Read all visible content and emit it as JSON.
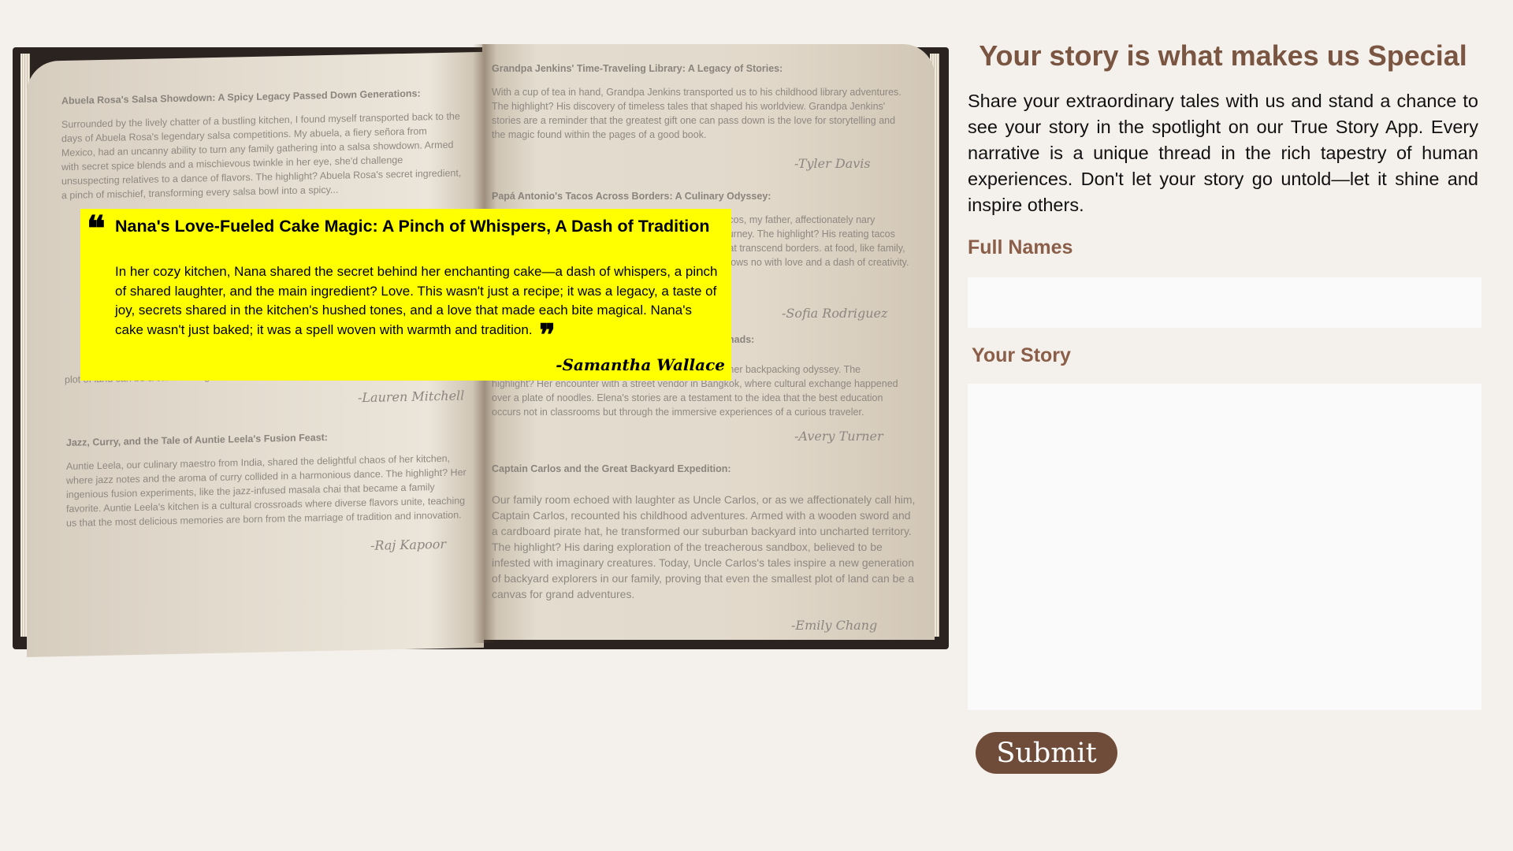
{
  "book": {
    "left_page": [
      {
        "title": "Abuela Rosa's Salsa Showdown: A Spicy Legacy Passed Down Generations:",
        "body": "Surrounded by the lively chatter of a bustling kitchen, I found myself transported back to the days of Abuela Rosa's legendary salsa competitions. My abuela, a fiery señora from Mexico, had an uncanny ability to turn any family gathering into a salsa showdown. Armed with secret spice blends and a mischievous twinkle in her eye, she'd challenge unsuspecting relatives to a dance of flavors. The highlight? Abuela Rosa's secret ingredient, a pinch of mischief, transforming every salsa bowl into a spicy..."
      },
      {
        "title": "",
        "body": "plot of land can be a canvas for grand adventures.",
        "author": "-Lauren Mitchell"
      },
      {
        "title": "Jazz, Curry, and the Tale of Auntie Leela's Fusion Feast:",
        "body": "Auntie Leela, our culinary maestro from India, shared the delightful chaos of her kitchen, where jazz notes and the aroma of curry collided in a harmonious dance. The highlight? Her ingenious fusion experiments, like the jazz-infused masala chai that became a family favorite. Auntie Leela's kitchen is a cultural crossroads where diverse flavors unite, teaching us that the most delicious memories are born from the marriage of tradition and innovation.",
        "author": "-Raj Kapoor"
      }
    ],
    "right_page": [
      {
        "title": "Grandpa Jenkins' Time-Traveling Library: A Legacy of Stories:",
        "body": "With a cup of tea in hand, Grandpa Jenkins transported us to his childhood library adventures. The highlight? His discovery of timeless tales that shaped his worldview. Grandpa Jenkins' stories are a reminder that the greatest gift one can pass down is the love for storytelling and the magic found within the pages of a good book.",
        "author": "-Tyler Davis"
      },
      {
        "title": "Papá Antonio's Tacos Across Borders: A Culinary Odyssey:",
        "body": "tacos, my father, affectionately nary journey. The highlight? His reating tacos that transcend borders. at food, like family, knows no with love and a dash of creativity.",
        "author": "-Sofia Rodriguez"
      },
      {
        "title": "nads:",
        "body": "highlight? Her encounter with a street vendor in Bangkok, where cultural exchange happened over a plate of noodles. Elena's stories are a testament to the idea that the best education occurs not in classrooms but through the immersive experiences of a curious traveler.",
        "body_prefix": "n her backpacking odyssey. The",
        "author": "-Avery Turner"
      },
      {
        "title": "Captain Carlos and the Great Backyard Expedition:",
        "body": "Our family room echoed with laughter as Uncle Carlos, or as we affectionately call him, Captain Carlos, recounted his childhood adventures. Armed with a wooden sword and a cardboard pirate hat, he transformed our suburban backyard into uncharted territory. The highlight? His daring exploration of the treacherous sandbox, believed to be infested with imaginary creatures. Today, Uncle Carlos's tales inspire a new generation of backyard explorers in our family, proving that even the smallest plot of land can be a canvas for grand adventures.",
        "author": "-Emily Chang"
      }
    ]
  },
  "featured": {
    "title": "Nana's Love-Fueled Cake Magic: A Pinch of Whispers, A Dash of Tradition",
    "body": "In her cozy kitchen, Nana shared the secret behind her enchanting cake—a dash of whispers, a pinch of shared laughter, and the main ingredient? Love. This wasn't just a recipe; it was a legacy, a taste of joy, secrets shared in the kitchen's hushed tones, and a love that made each bite magical. Nana's cake wasn't just baked; it was a spell woven with warmth and tradition.",
    "open_quote": "❝",
    "close_quote": "❞",
    "author": "-Samantha Wallace",
    "highlight_color": "#ffff00"
  },
  "form": {
    "heading": "Your story is what makes us Special",
    "intro": "Share your extraordinary tales with us and stand a chance to see your story in the spotlight on our True Story App. Every narrative is a unique thread in the rich tapestry of human experiences. Don't let your story go untold—let it shine and inspire others.",
    "name_label": "Full Names",
    "name_value": "",
    "story_label": "Your Story",
    "story_value": "",
    "submit_label": "Submit"
  },
  "colors": {
    "background": "#f4f1ec",
    "heading": "#7a5642",
    "label": "#8a5e48",
    "button": "#6f4c3a"
  }
}
